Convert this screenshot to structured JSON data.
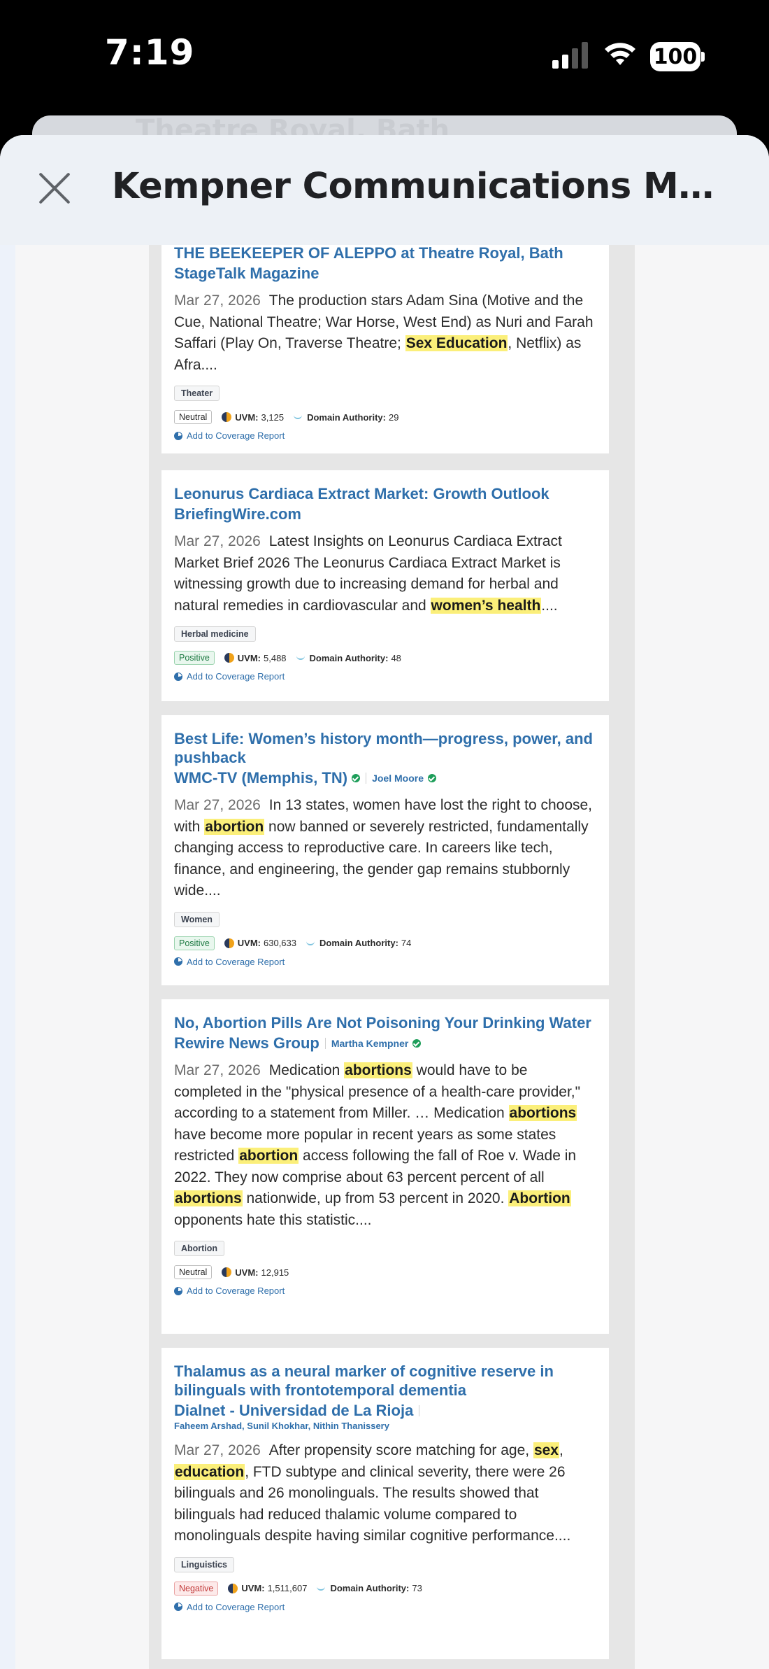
{
  "status_bar": {
    "time": "7:19",
    "battery": "100"
  },
  "back_sheet": {
    "title": "Theatre Royal, Bath"
  },
  "header": {
    "title": "Kempner Communications Mail -..."
  },
  "icons": {
    "close": "close-icon",
    "uvm": "uvm-icon",
    "domain_authority": "domain-authority-icon",
    "coverage": "pie-chart-icon",
    "verified": "verified-check-icon"
  },
  "colors": {
    "link": "#2f6fab",
    "highlight": "#fbef7a",
    "positive": "#1d7a42",
    "negative": "#c23b3b",
    "verified": "#1e9e5a"
  },
  "labels": {
    "uvm": "UVM:",
    "domain_authority": "Domain Authority:",
    "add_to_report": "Add to Coverage Report"
  },
  "articles": [
    {
      "headline": "THE BEEKEEPER OF ALEPPO at Theatre Royal, Bath",
      "source": "StageTalk Magazine",
      "date": "Mar 27, 2026",
      "snippet_a": "The production stars Adam Sina (Motive and the Cue, National Theatre; War Horse, West End) as Nuri and Farah Saffari (Play On, Traverse Theatre; ",
      "hl_a": "Sex Education",
      "snippet_b": ", Netflix) as Afra....",
      "tag": "Theater",
      "sentiment": "Neutral",
      "uvm": "3,125",
      "domain_authority": "29"
    },
    {
      "headline": "Leonurus Cardiaca Extract Market: Growth Outlook",
      "source": "BriefingWire.com",
      "date": "Mar 27, 2026",
      "snippet_a": "Latest Insights on Leonurus Cardiaca Extract Market Brief 2026 The Leonurus Cardiaca Extract Market is witnessing growth due to increasing demand for herbal and natural remedies in cardiovascular and ",
      "hl_a": "women’s health",
      "snippet_b": "....",
      "tag": "Herbal medicine",
      "sentiment": "Positive",
      "uvm": "5,488",
      "domain_authority": "48"
    },
    {
      "headline": "Best Life: Women’s history month—progress, power, and pushback",
      "source": "WMC-TV (Memphis, TN)",
      "author": "Joel Moore",
      "date": "Mar 27, 2026",
      "snippet_a": "In 13 states, women have lost the right to choose, with ",
      "hl_a": "abortion",
      "snippet_b": " now banned or severely restricted, fundamentally changing access to reproductive care. In careers like tech, finance, and engineering, the gender gap remains stubbornly wide....",
      "tag": "Women",
      "sentiment": "Positive",
      "uvm": "630,633",
      "domain_authority": "74"
    },
    {
      "headline": "No, Abortion Pills Are Not Poisoning Your Drinking Water",
      "source": "Rewire News Group",
      "author": "Martha Kempner",
      "date": "Mar 27, 2026",
      "snippet_a": "Medication ",
      "hl_a": "abortions",
      "snippet_b": " would have to be completed in the \"physical presence of a health-care provider,\" according to a statement from Miller. … Medication ",
      "hl_b": "abortions",
      "snippet_c": " have become more popular in recent years as some states restricted ",
      "hl_c": "abortion",
      "snippet_d": " access following the fall of Roe v. Wade in 2022. They now comprise about 63 percent percent of all ",
      "hl_d": "abortions",
      "snippet_e": " nationwide, up from 53 percent in 2020.  ",
      "hl_e": "Abortion",
      "snippet_f": " opponents hate this statistic....",
      "tag": "Abortion",
      "sentiment": "Neutral",
      "uvm": "12,915"
    },
    {
      "headline": "Thalamus as a neural marker of cognitive reserve in bilinguals with frontotemporal dementia",
      "source": "Dialnet - Universidad de La Rioja",
      "authors": "Faheem Arshad, Sunil Khokhar, Nithin Thanissery",
      "date": "Mar 27, 2026",
      "snippet_a": "After propensity score matching for age, ",
      "hl_a": "sex",
      "snippet_b": ", ",
      "hl_b": "education",
      "snippet_c": ", FTD subtype and clinical severity, there were 26 bilinguals and 26 monolinguals. The results showed that bilinguals had reduced thalamic volume compared to monolinguals despite having similar cognitive performance....",
      "tag": "Linguistics",
      "sentiment": "Negative",
      "uvm": "1,511,607",
      "domain_authority": "73"
    }
  ]
}
